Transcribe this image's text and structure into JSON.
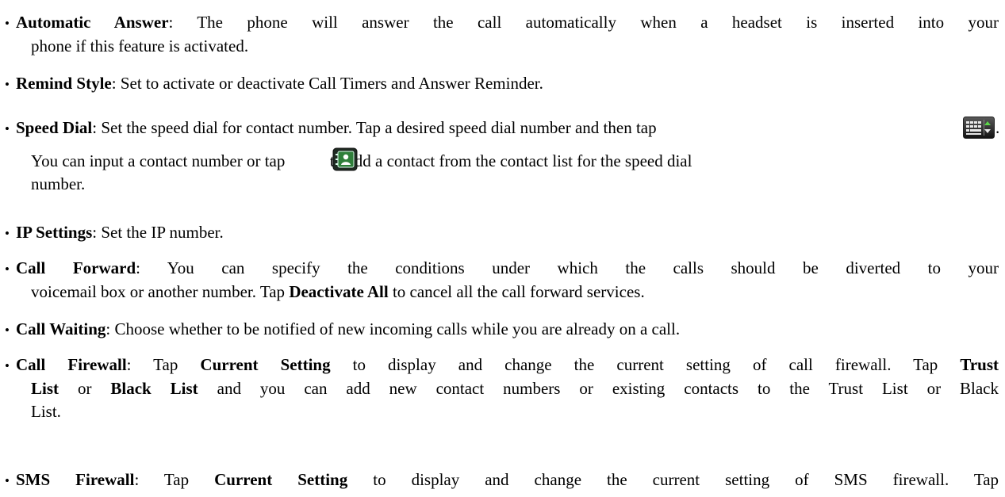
{
  "items": [
    {
      "term": "Automatic Answer",
      "line1": ": The phone will answer the call automatically when a headset is inserted into your",
      "line2": "phone if this feature is activated."
    },
    {
      "term": "Remind Style",
      "text": ": Set to activate or deactivate Call Timers and Answer Reminder."
    },
    {
      "term": "Speed Dial",
      "line1": ": Set the speed dial for contact number. Tap a desired speed dial number and then tap",
      "line1_end": ".",
      "line2a": "You can input a contact number or tap",
      "line2b": "to add a contact from the contact list for the speed dial",
      "line3": "number.",
      "icon1": "keyboard-icon",
      "icon2": "contact-picker-icon"
    },
    {
      "term": "IP Settings",
      "text": ": Set the IP number."
    },
    {
      "term": "Call Forward",
      "line1": ": You can specify the conditions under which the calls should be diverted to your",
      "line2a": "voicemail box or another number. Tap",
      "line2b": "Deactivate All",
      "line2c": "to cancel all the call forward services."
    },
    {
      "term": "Call Waiting",
      "text": ": Choose whether to be notified of new incoming calls while you are already on a call."
    },
    {
      "term": "Call Firewall",
      "line1a": ": Tap",
      "line1b": "Current Setting",
      "line1c": "to display and change the current setting of call firewall. Tap",
      "line1d": "Trust",
      "line2a": "List",
      "line2b": "or",
      "line2c": "Black List",
      "line2d": "and you can add new contact numbers or existing contacts to the Trust List or Black",
      "line3": "List."
    },
    {
      "term": "SMS Firewall",
      "line1a": ": Tap",
      "line1b": "Current Setting",
      "line1c": "to display and change the current setting of SMS firewall. Tap"
    }
  ]
}
